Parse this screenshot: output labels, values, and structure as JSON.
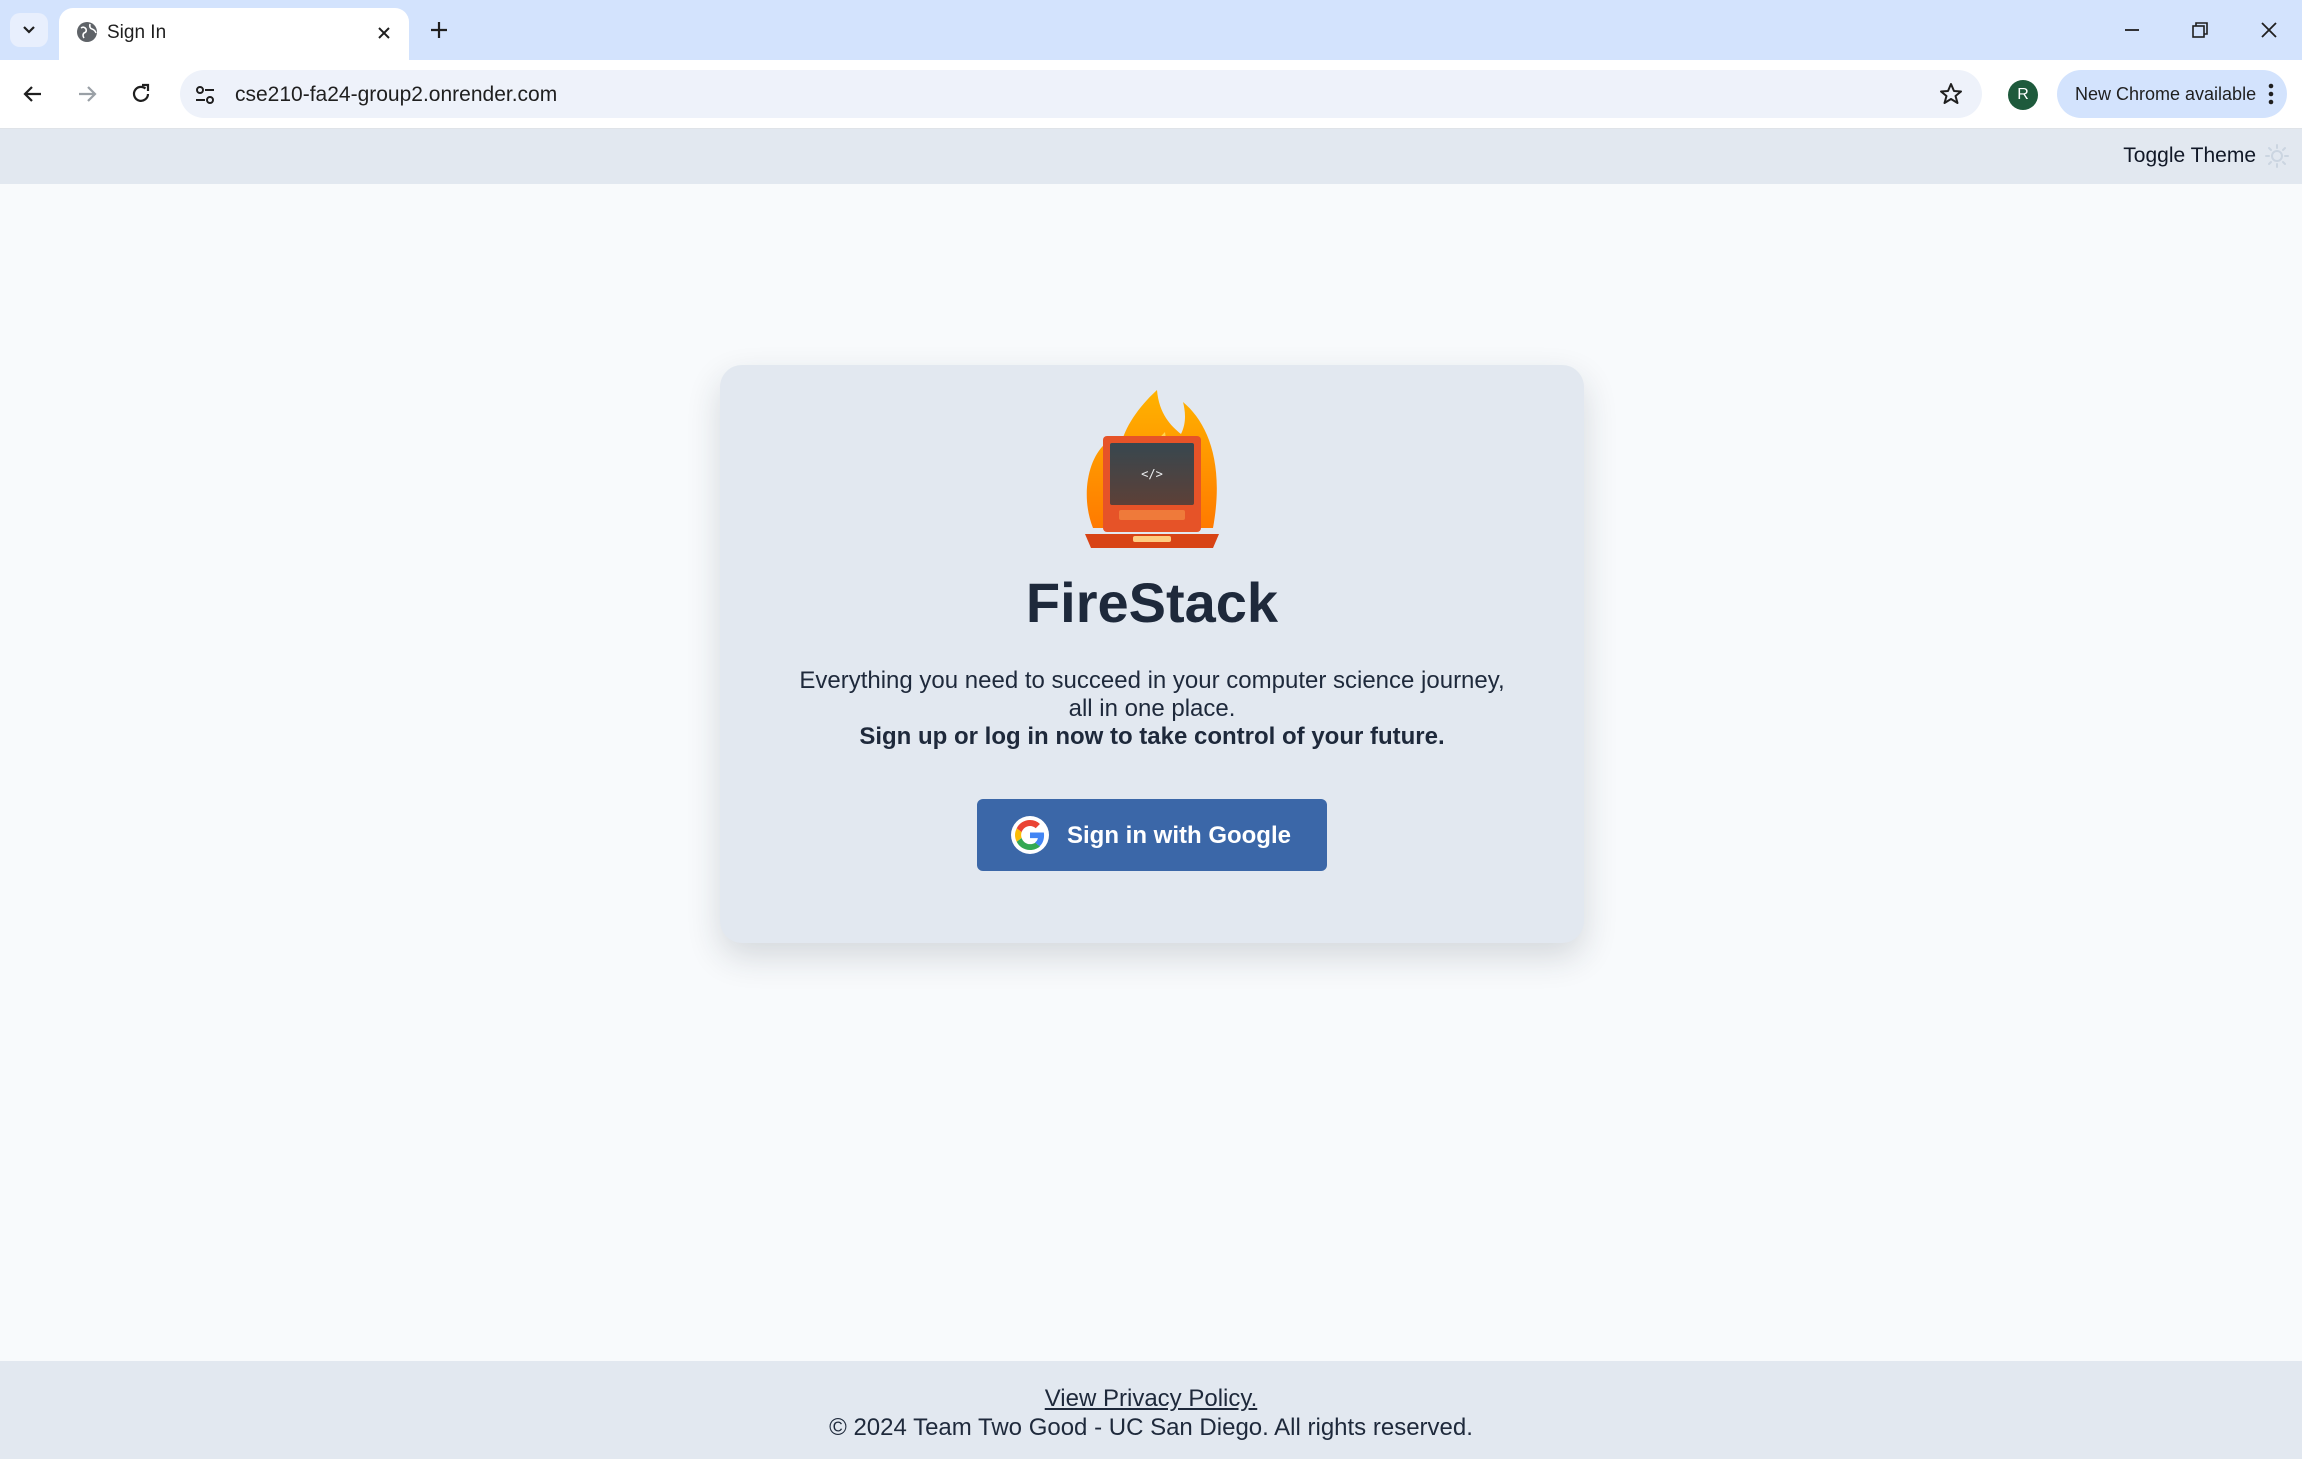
{
  "browser": {
    "tab_title": "Sign In",
    "url": "cse210-fa24-group2.onrender.com",
    "profile_initial": "R",
    "update_label": "New Chrome available"
  },
  "header": {
    "toggle_theme_label": "Toggle Theme"
  },
  "card": {
    "brand": "FireStack",
    "tagline_line1": "Everything you need to succeed in your computer science journey,",
    "tagline_line2": "all in one place.",
    "tagline_strong": "Sign up or log in now to take control of your future.",
    "signin_label": "Sign in with Google",
    "logo_code_text": "</>"
  },
  "footer": {
    "privacy_link": "View Privacy Policy.",
    "copyright": "© 2024 Team Two Good - UC San Diego. All rights reserved."
  },
  "colors": {
    "page_bg": "#f8fafc",
    "card_bg": "#e2e8f0",
    "button_bg": "#3b67a8",
    "tabstrip_bg": "#d3e3fd"
  }
}
